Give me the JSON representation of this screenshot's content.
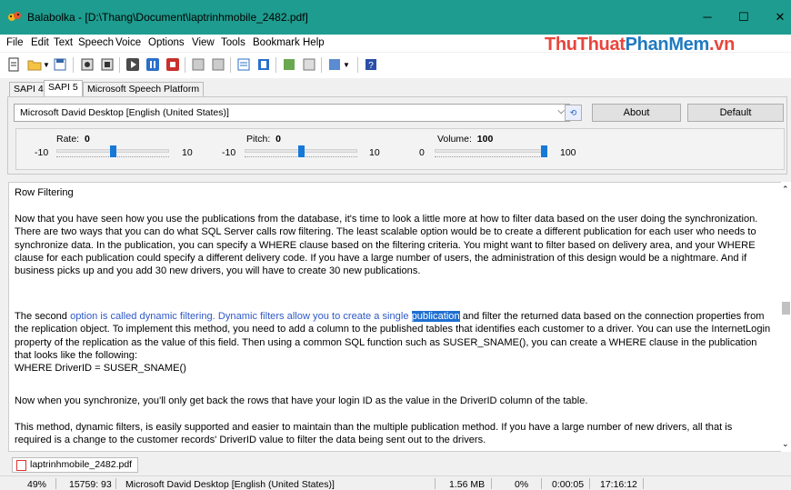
{
  "window": {
    "title": "Balabolka - [D:\\Thang\\Document\\laptrinhmobile_2482.pdf]",
    "min": "─",
    "max": "☐",
    "close": "✕"
  },
  "menu": [
    "File",
    "Edit",
    "Text",
    "Speech",
    "Voice",
    "Options",
    "View",
    "Tools",
    "Bookmark",
    "Help"
  ],
  "watermark": {
    "part1": "ThuThuat",
    "part2": "PhanMem",
    "part3": ".vn"
  },
  "tabs": [
    "SAPI 4",
    "SAPI 5",
    "Microsoft Speech Platform"
  ],
  "voice": {
    "selected": "Microsoft David Desktop [English (United States)]",
    "about": "About",
    "default": "Default"
  },
  "sliders": {
    "rate": {
      "label": "Rate:",
      "value": "0",
      "min": "-10",
      "max": "10",
      "level": 0.5
    },
    "pitch": {
      "label": "Pitch:",
      "value": "0",
      "min": "-10",
      "max": "10",
      "level": 0.5
    },
    "volume": {
      "label": "Volume:",
      "value": "100",
      "min": "0",
      "max": "100",
      "level": 1.0
    }
  },
  "document": {
    "heading": "Row Filtering",
    "p1": "Now that you have seen how you use the publications from the database, it's time to look a little more at how to filter data based on the user doing the synchronization. There are two ways that you can do what SQL Server calls row filtering. The least scalable option would be to create a different publication for each user who needs to synchronize data. In the publication, you can specify a WHERE clause based on the filtering criteria. You might want to filter based on delivery area, and your WHERE clause for each publication could specify a different delivery code. If you have a large number of users, the administration of this design would be a nightmare. And if business picks up and you add 30 new drivers, you will have to create 30 new publications.",
    "p2_start": "The second ",
    "p2_blue": "option is called dynamic filtering. Dynamic filters allow you to create a single ",
    "p2_hl": "publication",
    "p2_rest": " and filter the returned data based on the connection properties from the replication object. To implement this method, you need to add a column to the published tables that identifies each customer to a driver. You can use the InternetLogin property of the replication as the value of this field. Then using a common SQL function such as SUSER_SNAME(), you can create a WHERE clause in the publication that looks like the following:",
    "p2_code": "WHERE DriverID = SUSER_SNAME()",
    "p3": "Now when you synchronize, you'll only get back the rows that have your login ID as the value in the DriverID column of the table.",
    "p4": "This method, dynamic filters, is easily supported and easier to maintain than the multiple publication method. If you have a large number of new drivers, all that is required is a change to the customer records' DriverID value to filter the data being sent out to the drivers."
  },
  "file_tab": "laptrinhmobile_2482.pdf",
  "status": {
    "zoom": "49%",
    "position": "15759: 93",
    "voice": "Microsoft David Desktop [English (United States)]",
    "size": "1.56 MB",
    "percent": "0%",
    "elapsed": "0:00:05",
    "clock": "17:16:12"
  },
  "colors": {
    "titlebar": "#1e9c8f",
    "accent": "#1679d8",
    "highlight": "#1e6fd0",
    "link": "#2f59c6"
  }
}
